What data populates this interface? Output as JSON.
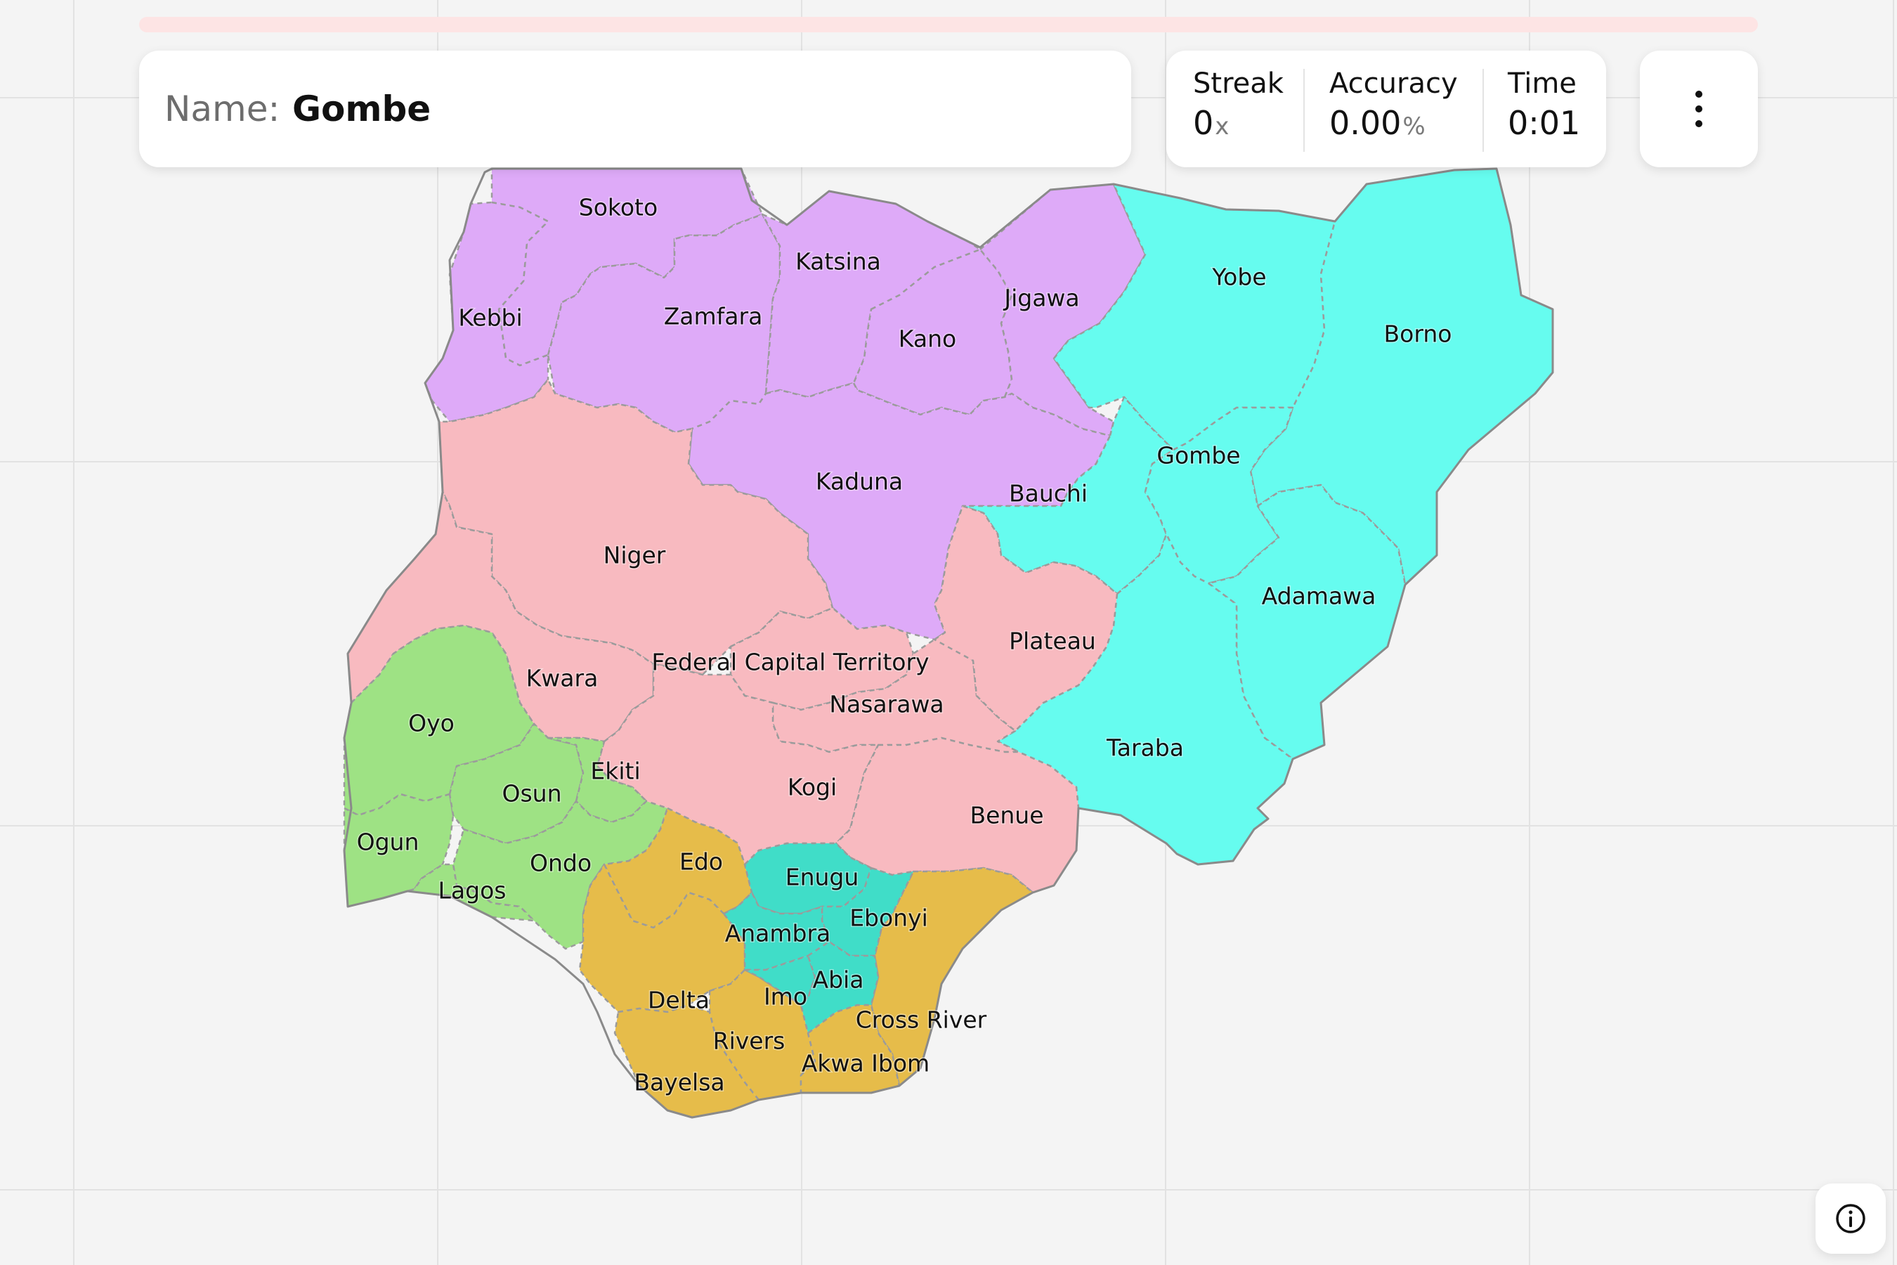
{
  "header": {
    "name_label": "Name:",
    "name_value": "Gombe"
  },
  "progress": {
    "fraction": 0
  },
  "stats": [
    {
      "label": "Streak",
      "value": "0",
      "unit": "x"
    },
    {
      "label": "Accuracy",
      "value": "0.00",
      "unit": "%"
    },
    {
      "label": "Time",
      "value": "0:01",
      "unit": ""
    }
  ],
  "menu": {
    "icon": "more-vertical-icon"
  },
  "info": {
    "icon": "info-icon"
  },
  "map": {
    "region_colors": {
      "north_west": "#deaaf8",
      "north_east": "#66fcef",
      "north_central": "#f8bac0",
      "south_west": "#9ee284",
      "south_south": "#e6bc4a",
      "south_east": "#40ddc8"
    },
    "states": [
      {
        "name": "Sokoto",
        "region": "north_west"
      },
      {
        "name": "Kebbi",
        "region": "north_west"
      },
      {
        "name": "Zamfara",
        "region": "north_west"
      },
      {
        "name": "Katsina",
        "region": "north_west"
      },
      {
        "name": "Kano",
        "region": "north_west"
      },
      {
        "name": "Jigawa",
        "region": "north_west"
      },
      {
        "name": "Kaduna",
        "region": "north_west"
      },
      {
        "name": "Yobe",
        "region": "north_east"
      },
      {
        "name": "Borno",
        "region": "north_east"
      },
      {
        "name": "Bauchi",
        "region": "north_east"
      },
      {
        "name": "Gombe",
        "region": "north_east"
      },
      {
        "name": "Adamawa",
        "region": "north_east"
      },
      {
        "name": "Taraba",
        "region": "north_east"
      },
      {
        "name": "Niger",
        "region": "north_central"
      },
      {
        "name": "Kwara",
        "region": "north_central"
      },
      {
        "name": "Federal Capital Territory",
        "region": "north_central"
      },
      {
        "name": "Nasarawa",
        "region": "north_central"
      },
      {
        "name": "Plateau",
        "region": "north_central"
      },
      {
        "name": "Kogi",
        "region": "north_central"
      },
      {
        "name": "Benue",
        "region": "north_central"
      },
      {
        "name": "Oyo",
        "region": "south_west"
      },
      {
        "name": "Ogun",
        "region": "south_west"
      },
      {
        "name": "Osun",
        "region": "south_west"
      },
      {
        "name": "Ekiti",
        "region": "south_west"
      },
      {
        "name": "Ondo",
        "region": "south_west"
      },
      {
        "name": "Lagos",
        "region": "south_west"
      },
      {
        "name": "Edo",
        "region": "south_south"
      },
      {
        "name": "Delta",
        "region": "south_south"
      },
      {
        "name": "Bayelsa",
        "region": "south_south"
      },
      {
        "name": "Rivers",
        "region": "south_south"
      },
      {
        "name": "Cross River",
        "region": "south_south"
      },
      {
        "name": "Akwa Ibom",
        "region": "south_south"
      },
      {
        "name": "Enugu",
        "region": "south_east"
      },
      {
        "name": "Ebonyi",
        "region": "south_east"
      },
      {
        "name": "Anambra",
        "region": "south_east"
      },
      {
        "name": "Imo",
        "region": "south_east"
      },
      {
        "name": "Abia",
        "region": "south_east"
      }
    ]
  }
}
